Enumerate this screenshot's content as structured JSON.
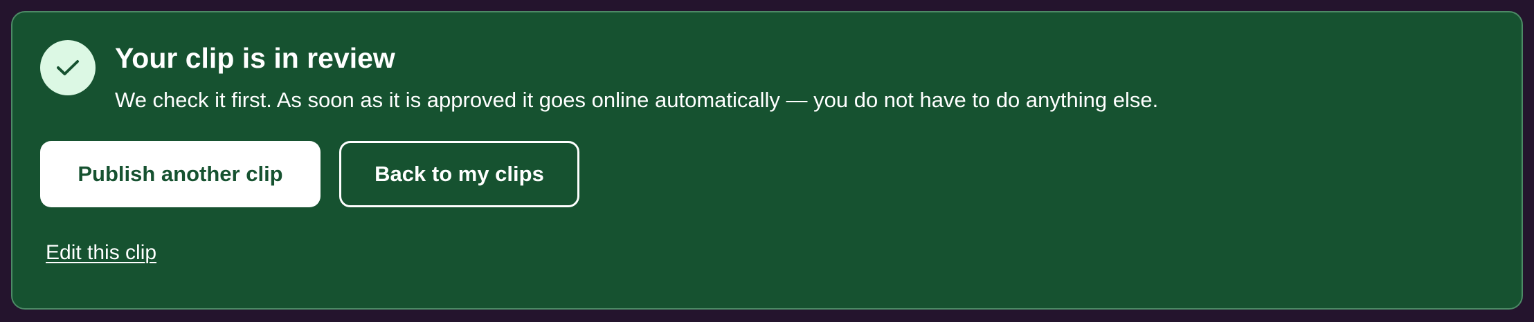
{
  "notice": {
    "icon": "checkmark-icon",
    "title": "Your clip is in review",
    "description": "We check it first. As soon as it is approved it goes online automatically — you do not have to do anything else."
  },
  "actions": {
    "primary_label": "Publish another clip",
    "secondary_label": "Back to my clips",
    "edit_link_label": "Edit this clip"
  },
  "colors": {
    "page_background": "#24142d",
    "card_background": "#165230",
    "card_border": "#4d8a66",
    "icon_circle": "#dcf8e4",
    "accent_text": "#165230",
    "text": "#ffffff"
  }
}
